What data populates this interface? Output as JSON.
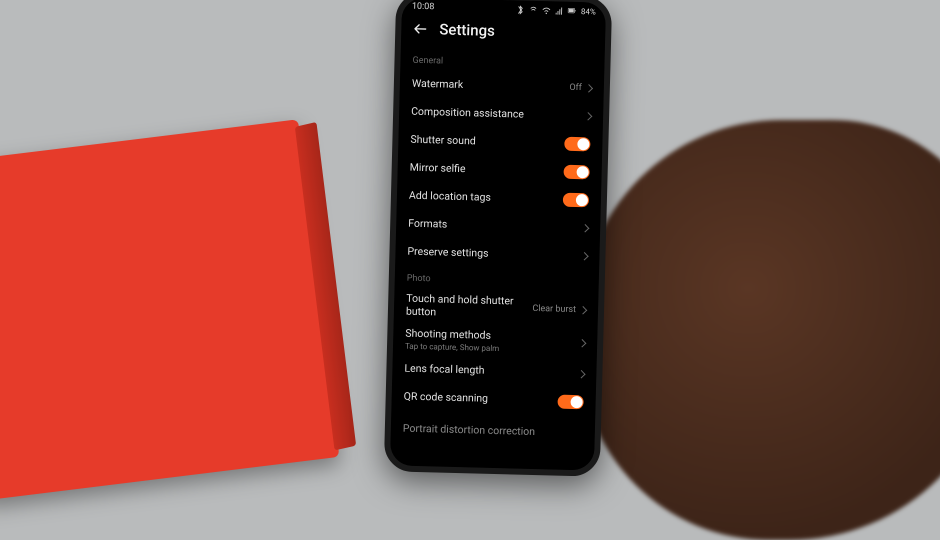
{
  "statusbar": {
    "time": "10:08",
    "battery": "84%"
  },
  "header": {
    "title": "Settings"
  },
  "sections": {
    "general": {
      "label": "General",
      "watermark": {
        "title": "Watermark",
        "value": "Off"
      },
      "composition": {
        "title": "Composition assistance"
      },
      "shutter_sound": {
        "title": "Shutter sound"
      },
      "mirror_selfie": {
        "title": "Mirror selfie"
      },
      "location_tags": {
        "title": "Add location tags"
      },
      "formats": {
        "title": "Formats"
      },
      "preserve": {
        "title": "Preserve settings"
      }
    },
    "photo": {
      "label": "Photo",
      "hold_shutter": {
        "title": "Touch and hold shutter button",
        "value": "Clear burst"
      },
      "shooting_methods": {
        "title": "Shooting methods",
        "sub": "Tap to capture, Show palm"
      },
      "lens_focal": {
        "title": "Lens focal length"
      },
      "qr": {
        "title": "QR code scanning"
      },
      "portrait": {
        "title": "Portrait distortion correction"
      }
    }
  },
  "box_number": "13"
}
